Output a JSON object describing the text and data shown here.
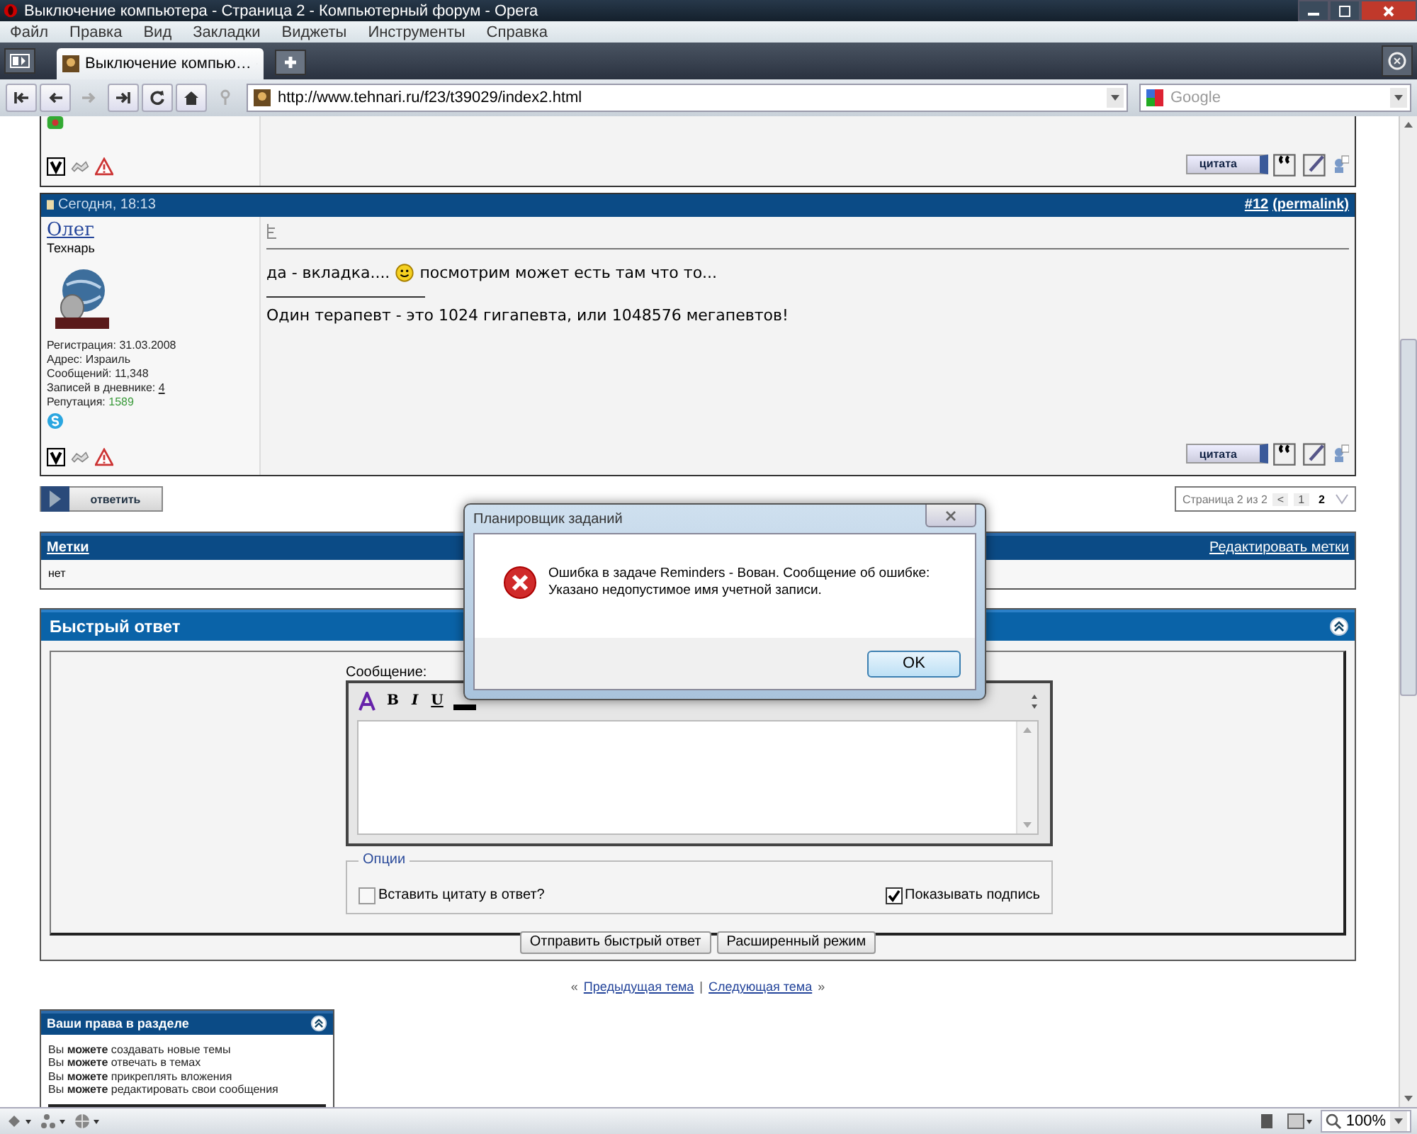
{
  "window": {
    "title": "Выключение компьютера - Страница 2 - Компьютерный форум - Opera"
  },
  "menu": [
    "Файл",
    "Правка",
    "Вид",
    "Закладки",
    "Виджеты",
    "Инструменты",
    "Справка"
  ],
  "tabs": [
    {
      "label": "Выключение компью…",
      "selected": true
    }
  ],
  "address_bar": {
    "url": "http://www.tehnari.ru/f23/t39029/index2.html"
  },
  "search": {
    "placeholder": "Google"
  },
  "previous_post": {
    "quote_button": "цитата"
  },
  "post": {
    "date": "Сегодня, 18:13",
    "number": "#12",
    "permalink": "(permalink)",
    "author": "Олег",
    "rank": "Технарь",
    "stats": [
      {
        "label": "Регистрация:",
        "value": "31.03.2008",
        "kind": "text"
      },
      {
        "label": "Адрес:",
        "value": "Израиль",
        "kind": "text"
      },
      {
        "label": "Сообщений:",
        "value": "11,348",
        "kind": "text"
      },
      {
        "label": "Записей в дневнике:",
        "value": "4",
        "kind": "link"
      },
      {
        "label": "Репутация:",
        "value": "1589",
        "kind": "reputation"
      }
    ],
    "message_before": "да - вкладка....",
    "message_after": "посмотрим может есть там что то...",
    "signature": "Один терапевт - это 1024 гигапевта, или 1048576 мегапевтов!",
    "quote_button": "цитата"
  },
  "reply_button": "ответить",
  "pagination": {
    "label": "Страница 2 из 2",
    "prev": "<",
    "pages": [
      {
        "label": "1",
        "selected": false
      },
      {
        "label": "2",
        "selected": true
      }
    ]
  },
  "tags": {
    "title": "Метки",
    "edit_link": "Редактировать метки",
    "value": "нет"
  },
  "quick_reply": {
    "title": "Быстрый ответ",
    "message_label": "Сообщение:",
    "toolbar": [
      "B",
      "I",
      "U"
    ],
    "options_legend": "Опции",
    "options": [
      {
        "label": "Вставить цитату в ответ?",
        "checked": false
      },
      {
        "label": "Показывать подпись",
        "checked": true
      }
    ],
    "buttons": [
      "Отправить быстрый ответ",
      "Расширенный режим"
    ]
  },
  "thread_nav": {
    "prev_mark": "«",
    "prev": "Предыдущая тема",
    "separator": "|",
    "next": "Следующая тема",
    "next_mark": "»"
  },
  "rights": {
    "title": "Ваши права в разделе",
    "items": [
      "Вы **можете** создавать новые темы",
      "Вы **можете** отвечать в темах",
      "Вы **можете** прикреплять вложения",
      "Вы **можете** редактировать свои сообщения"
    ]
  },
  "status_bar": {
    "zoom": "100%"
  },
  "dialog": {
    "title": "Планировщик заданий",
    "message": [
      "Ошибка в задаче Reminders - Вован. Сообщение об ошибке:",
      "Указано недопустимое имя учетной записи."
    ],
    "ok": "OK"
  }
}
